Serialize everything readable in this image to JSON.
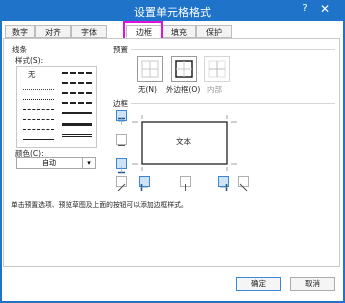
{
  "window": {
    "title": "设置单元格格式",
    "help": "?",
    "close": "✕"
  },
  "tabs": [
    "数字",
    "对齐",
    "字体",
    "边框",
    "填充",
    "保护"
  ],
  "selected_tab": "边框",
  "line": {
    "group_label": "线条",
    "style_label": "样式(S):",
    "none_label": "无",
    "color_label": "颜色(C):",
    "color_value": "自动"
  },
  "presets": {
    "group_label": "预置",
    "items": [
      {
        "label": "无(N)"
      },
      {
        "label": "外边框(O)"
      },
      {
        "label": "内部"
      }
    ]
  },
  "border": {
    "group_label": "边框",
    "preview_text": "文本"
  },
  "hint": "单击预置选项、预览草图及上面的按钮可以添加边框样式。",
  "buttons": {
    "ok": "确定",
    "cancel": "取消"
  },
  "colors": {
    "title_bar": "#1f74c9",
    "tab_highlight": "#e012e0",
    "selected_button": "#3b86d8"
  }
}
